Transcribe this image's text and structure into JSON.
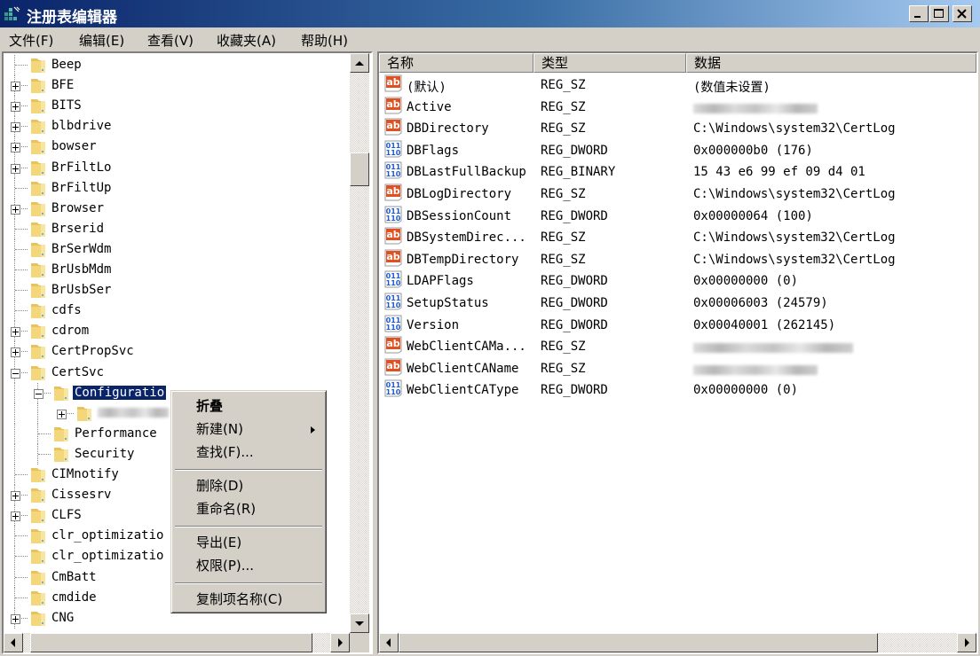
{
  "window": {
    "title": "注册表编辑器",
    "controls": [
      "minimize",
      "maximize",
      "close"
    ]
  },
  "menubar": {
    "items": [
      "文件(F)",
      "编辑(E)",
      "查看(V)",
      "收藏夹(A)",
      "帮助(H)"
    ]
  },
  "tree": {
    "items": [
      {
        "label": "Beep",
        "level": 0,
        "expander": "none"
      },
      {
        "label": "BFE",
        "level": 0,
        "expander": "plus"
      },
      {
        "label": "BITS",
        "level": 0,
        "expander": "plus"
      },
      {
        "label": "blbdrive",
        "level": 0,
        "expander": "plus"
      },
      {
        "label": "bowser",
        "level": 0,
        "expander": "plus"
      },
      {
        "label": "BrFiltLo",
        "level": 0,
        "expander": "plus"
      },
      {
        "label": "BrFiltUp",
        "level": 0,
        "expander": "none"
      },
      {
        "label": "Browser",
        "level": 0,
        "expander": "plus"
      },
      {
        "label": "Brserid",
        "level": 0,
        "expander": "none"
      },
      {
        "label": "BrSerWdm",
        "level": 0,
        "expander": "none"
      },
      {
        "label": "BrUsbMdm",
        "level": 0,
        "expander": "none"
      },
      {
        "label": "BrUsbSer",
        "level": 0,
        "expander": "none"
      },
      {
        "label": "cdfs",
        "level": 0,
        "expander": "none"
      },
      {
        "label": "cdrom",
        "level": 0,
        "expander": "plus"
      },
      {
        "label": "CertPropSvc",
        "level": 0,
        "expander": "plus"
      },
      {
        "label": "CertSvc",
        "level": 0,
        "expander": "minus"
      },
      {
        "label": "Configuratio",
        "level": 1,
        "expander": "minus",
        "selected": true
      },
      {
        "label": "",
        "level": 2,
        "expander": "plus",
        "redacted": true
      },
      {
        "label": "Performance",
        "level": 1,
        "expander": "none"
      },
      {
        "label": "Security",
        "level": 1,
        "expander": "none"
      },
      {
        "label": "CIMnotify",
        "level": 0,
        "expander": "none"
      },
      {
        "label": "Cissesrv",
        "level": 0,
        "expander": "plus"
      },
      {
        "label": "CLFS",
        "level": 0,
        "expander": "plus"
      },
      {
        "label": "clr_optimizatio",
        "level": 0,
        "expander": "none"
      },
      {
        "label": "clr_optimizatio",
        "level": 0,
        "expander": "none"
      },
      {
        "label": "CmBatt",
        "level": 0,
        "expander": "none"
      },
      {
        "label": "cmdide",
        "level": 0,
        "expander": "none"
      },
      {
        "label": "CNG",
        "level": 0,
        "expander": "plus"
      }
    ]
  },
  "list": {
    "columns": [
      "名称",
      "类型",
      "数据"
    ],
    "rows": [
      {
        "icon": "string-value-icon",
        "name": "(默认)",
        "type": "REG_SZ",
        "data": "(数值未设置)"
      },
      {
        "icon": "string-value-icon",
        "name": "Active",
        "type": "REG_SZ",
        "data": "",
        "redacted": true
      },
      {
        "icon": "string-value-icon",
        "name": "DBDirectory",
        "type": "REG_SZ",
        "data": "C:\\Windows\\system32\\CertLog"
      },
      {
        "icon": "binary-value-icon",
        "name": "DBFlags",
        "type": "REG_DWORD",
        "data": "0x000000b0 (176)"
      },
      {
        "icon": "binary-value-icon",
        "name": "DBLastFullBackup",
        "type": "REG_BINARY",
        "data": "15 43 e6 99 ef 09 d4 01"
      },
      {
        "icon": "string-value-icon",
        "name": "DBLogDirectory",
        "type": "REG_SZ",
        "data": "C:\\Windows\\system32\\CertLog"
      },
      {
        "icon": "binary-value-icon",
        "name": "DBSessionCount",
        "type": "REG_DWORD",
        "data": "0x00000064 (100)"
      },
      {
        "icon": "string-value-icon",
        "name": "DBSystemDirec...",
        "type": "REG_SZ",
        "data": "C:\\Windows\\system32\\CertLog"
      },
      {
        "icon": "string-value-icon",
        "name": "DBTempDirectory",
        "type": "REG_SZ",
        "data": "C:\\Windows\\system32\\CertLog"
      },
      {
        "icon": "binary-value-icon",
        "name": "LDAPFlags",
        "type": "REG_DWORD",
        "data": "0x00000000 (0)"
      },
      {
        "icon": "binary-value-icon",
        "name": "SetupStatus",
        "type": "REG_DWORD",
        "data": "0x00006003 (24579)"
      },
      {
        "icon": "binary-value-icon",
        "name": "Version",
        "type": "REG_DWORD",
        "data": "0x00040001 (262145)"
      },
      {
        "icon": "string-value-icon",
        "name": "WebClientCAMa...",
        "type": "REG_SZ",
        "data": "",
        "redacted": true
      },
      {
        "icon": "string-value-icon",
        "name": "WebClientCAName",
        "type": "REG_SZ",
        "data": "",
        "redacted": true
      },
      {
        "icon": "binary-value-icon",
        "name": "WebClientCAType",
        "type": "REG_DWORD",
        "data": "0x00000000 (0)"
      }
    ]
  },
  "context_menu": {
    "items": [
      {
        "label": "折叠",
        "bold": true
      },
      {
        "label": "新建(N)",
        "submenu": true
      },
      {
        "label": "查找(F)..."
      },
      {
        "separator": true
      },
      {
        "label": "删除(D)"
      },
      {
        "label": "重命名(R)"
      },
      {
        "separator": true
      },
      {
        "label": "导出(E)"
      },
      {
        "label": "权限(P)..."
      },
      {
        "separator": true
      },
      {
        "label": "复制项名称(C)"
      }
    ]
  }
}
